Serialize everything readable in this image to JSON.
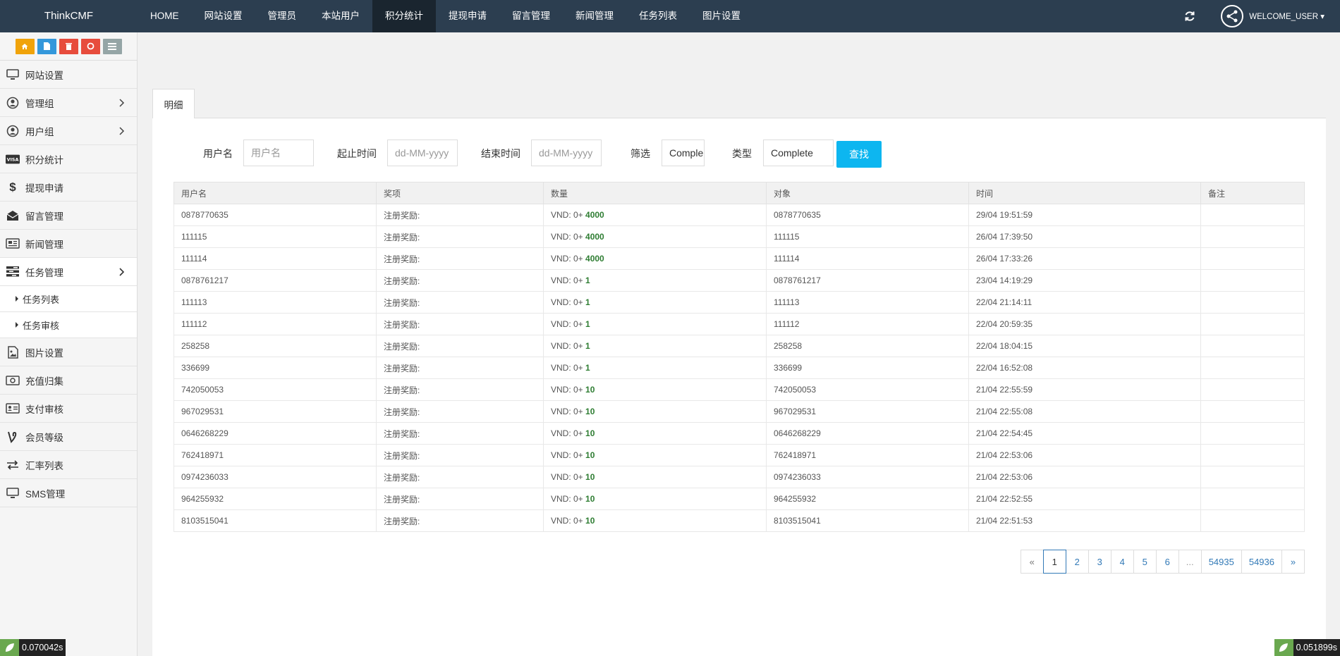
{
  "brand": "ThinkCMF",
  "nav": [
    "HOME",
    "网站设置",
    "管理员",
    "本站用户",
    "积分统计",
    "提现申请",
    "留言管理",
    "新闻管理",
    "任务列表",
    "图片设置"
  ],
  "nav_active": 4,
  "user": {
    "name": "WELCOME_USER"
  },
  "sidebar": {
    "items": [
      {
        "label": "网站设置"
      },
      {
        "label": "管理组"
      },
      {
        "label": "用户组"
      },
      {
        "label": "积分统计"
      },
      {
        "label": "提现申请"
      },
      {
        "label": "留言管理"
      },
      {
        "label": "新闻管理"
      },
      {
        "label": "任务管理"
      },
      {
        "label": "图片设置"
      },
      {
        "label": "充值归集"
      },
      {
        "label": "支付审核"
      },
      {
        "label": "会员等级"
      },
      {
        "label": "汇率列表"
      },
      {
        "label": "SMS管理"
      }
    ],
    "sub_items": [
      {
        "label": "任务列表"
      },
      {
        "label": "任务审核"
      }
    ]
  },
  "tab": {
    "label": "明细"
  },
  "filters": {
    "username_label": "用户名",
    "username_placeholder": "用户名",
    "start_label": "起止时间",
    "start_placeholder": "dd-MM-yyyy",
    "end_label": "结束时间",
    "end_placeholder": "dd-MM-yyyy",
    "filter_label": "筛选",
    "filter_value": "Comple",
    "type_label": "类型",
    "type_value": "Complete",
    "search_label": "查找"
  },
  "table": {
    "headers": [
      "用户名",
      "奖项",
      "数量",
      "对象",
      "时间",
      "备注"
    ],
    "rows": [
      {
        "user": "0878770635",
        "award": "注册奖励:",
        "prefix": "VND: 0+",
        "amount": "4000",
        "target": "0878770635",
        "time": "29/04 19:51:59",
        "note": ""
      },
      {
        "user": "111115",
        "award": "注册奖励:",
        "prefix": "VND: 0+",
        "amount": "4000",
        "target": "111115",
        "time": "26/04 17:39:50",
        "note": ""
      },
      {
        "user": "111114",
        "award": "注册奖励:",
        "prefix": "VND: 0+",
        "amount": "4000",
        "target": "111114",
        "time": "26/04 17:33:26",
        "note": ""
      },
      {
        "user": "0878761217",
        "award": "注册奖励:",
        "prefix": "VND: 0+",
        "amount": "1",
        "target": "0878761217",
        "time": "23/04 14:19:29",
        "note": ""
      },
      {
        "user": "111113",
        "award": "注册奖励:",
        "prefix": "VND: 0+",
        "amount": "1",
        "target": "111113",
        "time": "22/04 21:14:11",
        "note": ""
      },
      {
        "user": "111112",
        "award": "注册奖励:",
        "prefix": "VND: 0+",
        "amount": "1",
        "target": "111112",
        "time": "22/04 20:59:35",
        "note": ""
      },
      {
        "user": "258258",
        "award": "注册奖励:",
        "prefix": "VND: 0+",
        "amount": "1",
        "target": "258258",
        "time": "22/04 18:04:15",
        "note": ""
      },
      {
        "user": "336699",
        "award": "注册奖励:",
        "prefix": "VND: 0+",
        "amount": "1",
        "target": "336699",
        "time": "22/04 16:52:08",
        "note": ""
      },
      {
        "user": "742050053",
        "award": "注册奖励:",
        "prefix": "VND: 0+",
        "amount": "10",
        "target": "742050053",
        "time": "21/04 22:55:59",
        "note": ""
      },
      {
        "user": "967029531",
        "award": "注册奖励:",
        "prefix": "VND: 0+",
        "amount": "10",
        "target": "967029531",
        "time": "21/04 22:55:08",
        "note": ""
      },
      {
        "user": "0646268229",
        "award": "注册奖励:",
        "prefix": "VND: 0+",
        "amount": "10",
        "target": "0646268229",
        "time": "21/04 22:54:45",
        "note": ""
      },
      {
        "user": "762418971",
        "award": "注册奖励:",
        "prefix": "VND: 0+",
        "amount": "10",
        "target": "762418971",
        "time": "21/04 22:53:06",
        "note": ""
      },
      {
        "user": "0974236033",
        "award": "注册奖励:",
        "prefix": "VND: 0+",
        "amount": "10",
        "target": "0974236033",
        "time": "21/04 22:53:06",
        "note": ""
      },
      {
        "user": "964255932",
        "award": "注册奖励:",
        "prefix": "VND: 0+",
        "amount": "10",
        "target": "964255932",
        "time": "21/04 22:52:55",
        "note": ""
      },
      {
        "user": "8103515041",
        "award": "注册奖励:",
        "prefix": "VND: 0+",
        "amount": "10",
        "target": "8103515041",
        "time": "21/04 22:51:53",
        "note": ""
      }
    ]
  },
  "pagination": [
    "«",
    "1",
    "2",
    "3",
    "4",
    "5",
    "6",
    "...",
    "54935",
    "54936",
    "»"
  ],
  "pagination_active": 1,
  "timers": {
    "left": "0.070042s",
    "right": "0.051899s"
  },
  "colors": {
    "topbar": "#2c3e50",
    "search_button": "#0db6f0",
    "amount": "#2e7d32"
  }
}
